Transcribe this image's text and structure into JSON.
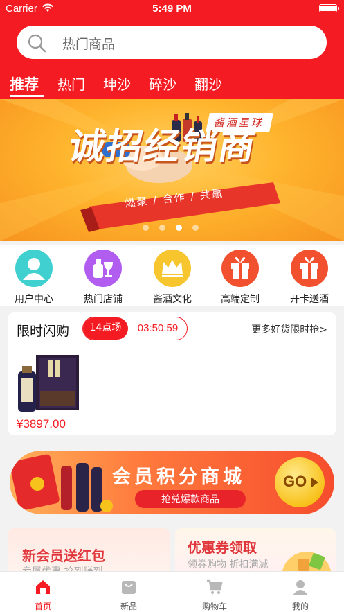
{
  "status_bar": {
    "carrier": "Carrier",
    "time": "5:49 PM"
  },
  "search": {
    "placeholder": "热门商品"
  },
  "tabs": [
    {
      "label": "推荐",
      "active": true
    },
    {
      "label": "热门"
    },
    {
      "label": "坤沙"
    },
    {
      "label": "碎沙"
    },
    {
      "label": "翻沙"
    }
  ],
  "banner": {
    "headline": "诚招经销商",
    "brand": "酱酒星球",
    "tagline": "燃聚 / 合作 / 共赢",
    "active_slide": 3,
    "slide_count": 4
  },
  "quick_menu": [
    {
      "label": "用户中心",
      "icon": "user-icon",
      "color": "#3fd0cf"
    },
    {
      "label": "热门店铺",
      "icon": "wine-icon",
      "color": "#b15ef0"
    },
    {
      "label": "酱酒文化",
      "icon": "crown-icon",
      "color": "#f7c52e"
    },
    {
      "label": "高端定制",
      "icon": "gift-icon",
      "color": "#f1512e"
    },
    {
      "label": "开卡送酒",
      "icon": "gift-icon",
      "color": "#f1512e"
    }
  ],
  "flash_sale": {
    "title": "限时闪购",
    "session": "14点场",
    "countdown": "03:50:59",
    "more": "更多好货限时抢>",
    "price": "¥3897.00"
  },
  "member_banner": {
    "title": "会员积分商城",
    "subtitle": "抢兑爆款商品",
    "go": "GO"
  },
  "promo_cards": [
    {
      "title": "新会员送红包",
      "subtitle": "专属优惠  抢到赚到"
    },
    {
      "title": "优惠券领取",
      "subtitle": "领券购物  折扣满减"
    }
  ],
  "tab_bar": [
    {
      "label": "首页",
      "icon": "home-icon",
      "active": true
    },
    {
      "label": "新品",
      "icon": "bag-icon"
    },
    {
      "label": "购物车",
      "icon": "cart-icon"
    },
    {
      "label": "我的",
      "icon": "profile-icon"
    }
  ],
  "colors": {
    "brand_red": "#f41c22",
    "banner_orange": "#ffb52e"
  }
}
